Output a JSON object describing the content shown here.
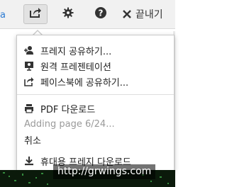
{
  "toolbar": {
    "left_fragment": "a",
    "share_icon": "share-icon",
    "settings_icon": "gear-icon",
    "help_icon": "help-icon",
    "close_label": "끝내기"
  },
  "menu": {
    "items": [
      {
        "label": "프레지 공유하기...",
        "icon": "add-user-icon"
      },
      {
        "label": "원격 프레젠테이션",
        "icon": "remote-present-icon"
      },
      {
        "label": "페이스북에 공유하기...",
        "icon": "share-out-icon"
      },
      {
        "label": "PDF 다운로드",
        "icon": "printer-icon"
      },
      {
        "label": "Adding page 6/24...",
        "icon": ""
      },
      {
        "label": "취소",
        "icon": ""
      },
      {
        "label": "휴대용 프레지 다운로드",
        "icon": "download-icon"
      }
    ]
  },
  "watermark": "http://grwings.com"
}
